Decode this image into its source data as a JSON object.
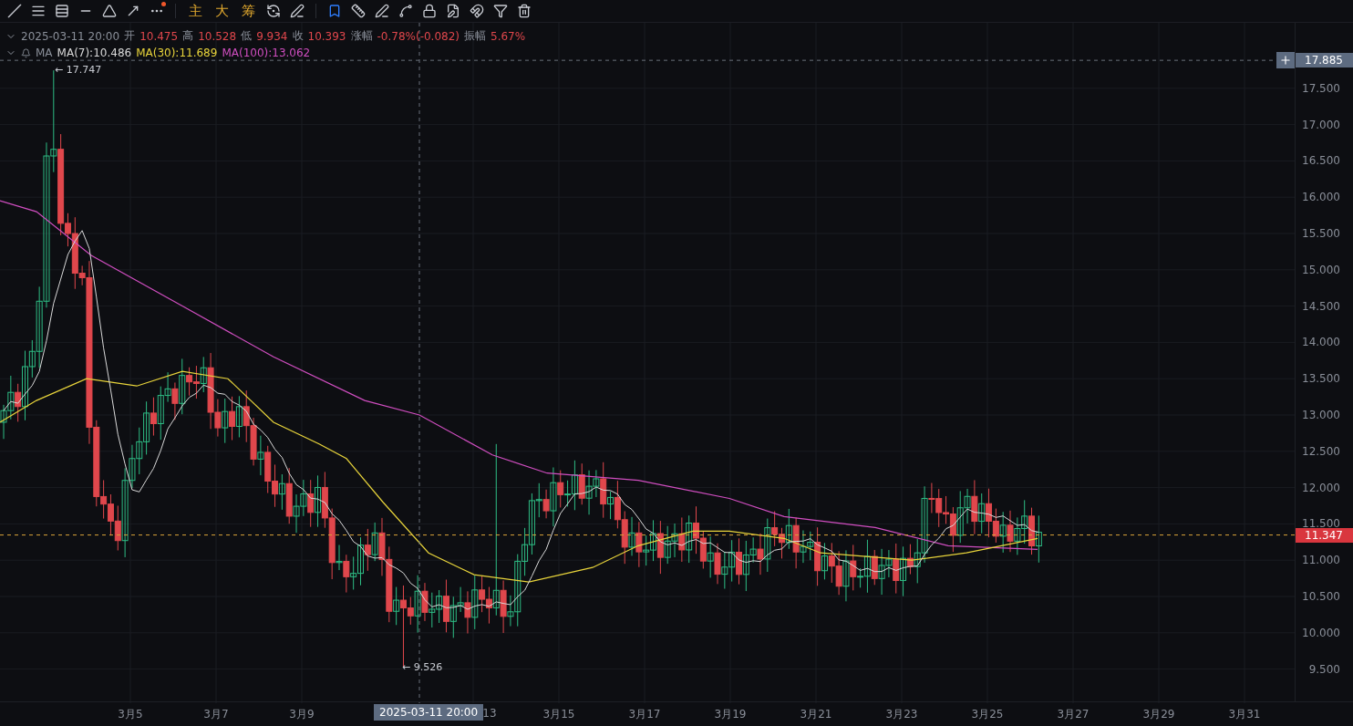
{
  "toolbar": {
    "indicator_buttons": [
      "主",
      "大",
      "筹"
    ],
    "more_has_notification": true
  },
  "info": {
    "datetime": "2025-03-11 20:00",
    "fields": [
      {
        "label": "开",
        "value": "10.475"
      },
      {
        "label": "高",
        "value": "10.528"
      },
      {
        "label": "低",
        "value": "9.934"
      },
      {
        "label": "收",
        "value": "10.393"
      },
      {
        "label": "涨幅",
        "value": "-0.78%(-0.082)"
      },
      {
        "label": "振幅",
        "value": "5.67%"
      }
    ]
  },
  "ma": {
    "label": "MA",
    "lines": [
      {
        "text": "MA(7):10.486",
        "color": "#d9d9d9"
      },
      {
        "text": "MA(30):11.689",
        "color": "#e8d43b"
      },
      {
        "text": "MA(100):13.062",
        "color": "#d04ec0"
      }
    ]
  },
  "y_axis": {
    "ticks": [
      "17.500",
      "17.000",
      "16.500",
      "16.000",
      "15.500",
      "15.000",
      "14.500",
      "14.000",
      "13.500",
      "13.000",
      "12.500",
      "12.000",
      "11.500",
      "11.000",
      "10.500",
      "10.000",
      "9.500"
    ]
  },
  "x_axis": {
    "labels": [
      "3月5",
      "3月7",
      "3月9",
      "13",
      "3月15",
      "3月17",
      "3月19",
      "3月21",
      "3月23",
      "3月25",
      "3月27",
      "3月29",
      "3月31"
    ]
  },
  "crosshair": {
    "time_label": "2025-03-11 20:00",
    "price_label": "17.885"
  },
  "last_price": "11.347",
  "annotations": {
    "high": "← 17.747",
    "low": "← 9.526"
  }
}
